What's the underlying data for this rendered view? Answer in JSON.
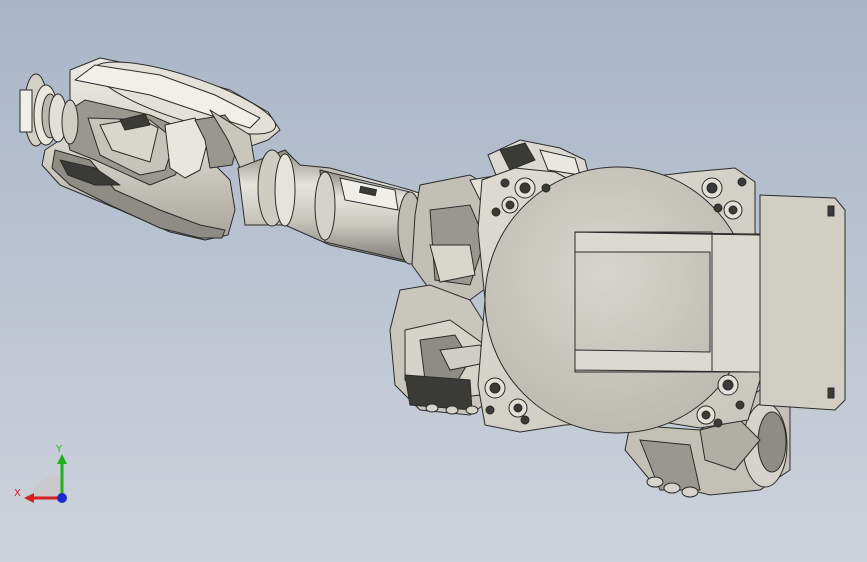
{
  "viewport": {
    "background_top": "#a9b5c7",
    "background_bottom": "#cdd3dc"
  },
  "model": {
    "body_color": "#d9d7cc",
    "shadow_color": "#9a988e",
    "edge_color": "#2b2b2b",
    "dark_color": "#3a3a38"
  },
  "triad": {
    "x_label": "X",
    "y_label": "Y",
    "x_color": "#d42020",
    "y_color": "#1bb51b",
    "z_color": "#1b2bd4"
  }
}
